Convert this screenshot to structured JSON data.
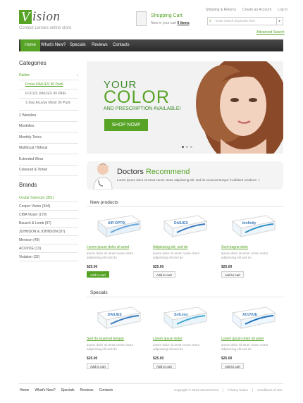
{
  "brand": {
    "logo_letter": "V",
    "logo_rest": "ision",
    "tagline": "Contact Lenses online store"
  },
  "cart": {
    "title": "Shopping Cart",
    "text_prefix": "Now in your cart",
    "items": "0 items"
  },
  "toplinks": [
    "Shipping & Returns",
    "Create an Account",
    "Log In"
  ],
  "search": {
    "placeholder": "Enter search keywords here",
    "advanced": "Advanced Search"
  },
  "nav": [
    "Home",
    "What's New?",
    "Specials",
    "Reviews",
    "Contacts"
  ],
  "categories": {
    "heading": "Categories",
    "items": [
      {
        "label": "Dailies",
        "active": true,
        "sub": false
      },
      {
        "label": "Focus DAILIES 30 Pack",
        "active": true,
        "sub": true
      },
      {
        "label": "FOCUS DAILIES 90 PAIR",
        "active": false,
        "sub": true
      },
      {
        "label": "1-Day Acuvue Moist 30 Pack",
        "active": false,
        "sub": true
      },
      {
        "label": "2 Weeklies",
        "active": false,
        "sub": false
      },
      {
        "label": "Monthlies",
        "active": false,
        "sub": false
      },
      {
        "label": "Monthly Torics",
        "active": false,
        "sub": false
      },
      {
        "label": "Multifocal / Bifocal",
        "active": false,
        "sub": false
      },
      {
        "label": "Extended Wear",
        "active": false,
        "sub": false
      },
      {
        "label": "Coloured & Tinted",
        "active": false,
        "sub": false
      }
    ]
  },
  "brands": {
    "heading": "Brands",
    "items": [
      {
        "label": "Ocular Sciences (351)",
        "active": true
      },
      {
        "label": "Cooper Vision (344)",
        "active": false
      },
      {
        "label": "CIBA Vision (179)",
        "active": false
      },
      {
        "label": "Bausch & Lomb (97)",
        "active": false
      },
      {
        "label": "JOHNSON & JOHNSON (97)",
        "active": false
      },
      {
        "label": "Menicon (49)",
        "active": false
      },
      {
        "label": "ACUVUE (13)",
        "active": false
      },
      {
        "label": "Vistakon (32)",
        "active": false
      }
    ]
  },
  "banner": {
    "line1": "YOUR",
    "line2": "COLOR",
    "line3": "AND PRESCRIPTION AVAILABLE!",
    "button": "SHOP NOW!"
  },
  "doctors": {
    "title_plain": "Doctors",
    "title_green": "Recommend",
    "text": "Lorem ipsum dolor sit amet conse ctetur adipisicing elit, sed do eiusmod tempor incididunt ut labore. »"
  },
  "new_products": {
    "heading": "New products",
    "items": [
      {
        "name": "Lorem ipsum dolor sit amet",
        "desc": "Ipsum dolor sit amet conse ctetur adipisicing elit sed do",
        "price": "$25.00",
        "button": "Add to cart",
        "brand_text": "AIR OPTIX"
      },
      {
        "name": "Adipisicing elit, sed do",
        "desc": "Ipsum dolor sit amet conse ctetur adipisicing elit sed do",
        "price": "$25.00",
        "button": "Add to cart",
        "brand_text": "DAILIES"
      },
      {
        "name": "Sed magna dolor",
        "desc": "Ipsum dolor sit amet conse ctetur adipisicing elit sed do",
        "price": "$25.00",
        "button": "Add to cart",
        "brand_text": "biofinity"
      }
    ]
  },
  "specials": {
    "heading": "Specials",
    "items": [
      {
        "name": "Sed do eiusmod tempor",
        "desc": "Ipsum dolor sit amet conse ctetur adipisicing elit sed do",
        "price": "$25.00",
        "button": "Add to cart",
        "brand_text": "DAILIES"
      },
      {
        "name": "Lorem ipsum dolor",
        "desc": "Ipsum dolor sit amet conse ctetur adipisicing elit sed do",
        "price": "$25.00",
        "button": "Add to cart",
        "brand_text": "SofLens"
      },
      {
        "name": "Lorem ipsum dolor sit amet",
        "desc": "Ipsum dolor sit amet conse ctetur adipisicing elit sed do",
        "price": "$25.00",
        "button": "Add to cart",
        "brand_text": "ACUVUE"
      }
    ]
  },
  "footer": {
    "links": [
      "Home",
      "What's New?",
      "Specials",
      "Reviews",
      "Contacts"
    ],
    "copyright": "Copyright © 2013 osCommerce",
    "privacy": "Privacy Notice",
    "conditions": "Conditions of Use"
  },
  "colors": {
    "accent": "#56a326",
    "nav_bg": "#333333"
  }
}
